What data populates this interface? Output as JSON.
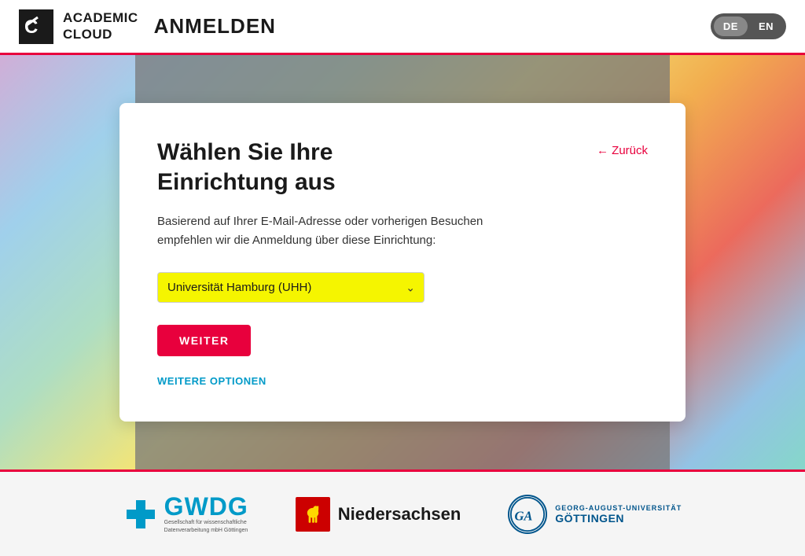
{
  "header": {
    "logo_text": "ACADEMIC\nCLOUD",
    "logo_line1": "ACADEMIC",
    "logo_line2": "CLOUD",
    "title": "ANMELDEN",
    "lang_de": "DE",
    "lang_en": "EN"
  },
  "card": {
    "heading": "Wählen Sie Ihre Einrichtung aus",
    "back_label": "← Zurück",
    "description": "Basierend auf Ihrer E-Mail-Adresse oder vorherigen Besuchen empfehlen wir die Anmeldung über diese Einrichtung:",
    "dropdown_value": "Universität Hamburg (UHH)",
    "weiter_label": "WEITER",
    "more_options_label": "WEITERE OPTIONEN"
  },
  "footer": {
    "gwdg_name": "GWDG",
    "gwdg_subtitle": "Gesellschaft für wissenschaftliche\nDatenverarbeitung mbH Göttingen",
    "niedersachsen_label": "Niedersachsen",
    "georg_top": "GEORG-AUGUST-UNIVERSITÄT",
    "georg_bottom": "GÖTTINGEN",
    "georg_initials": "GA"
  }
}
